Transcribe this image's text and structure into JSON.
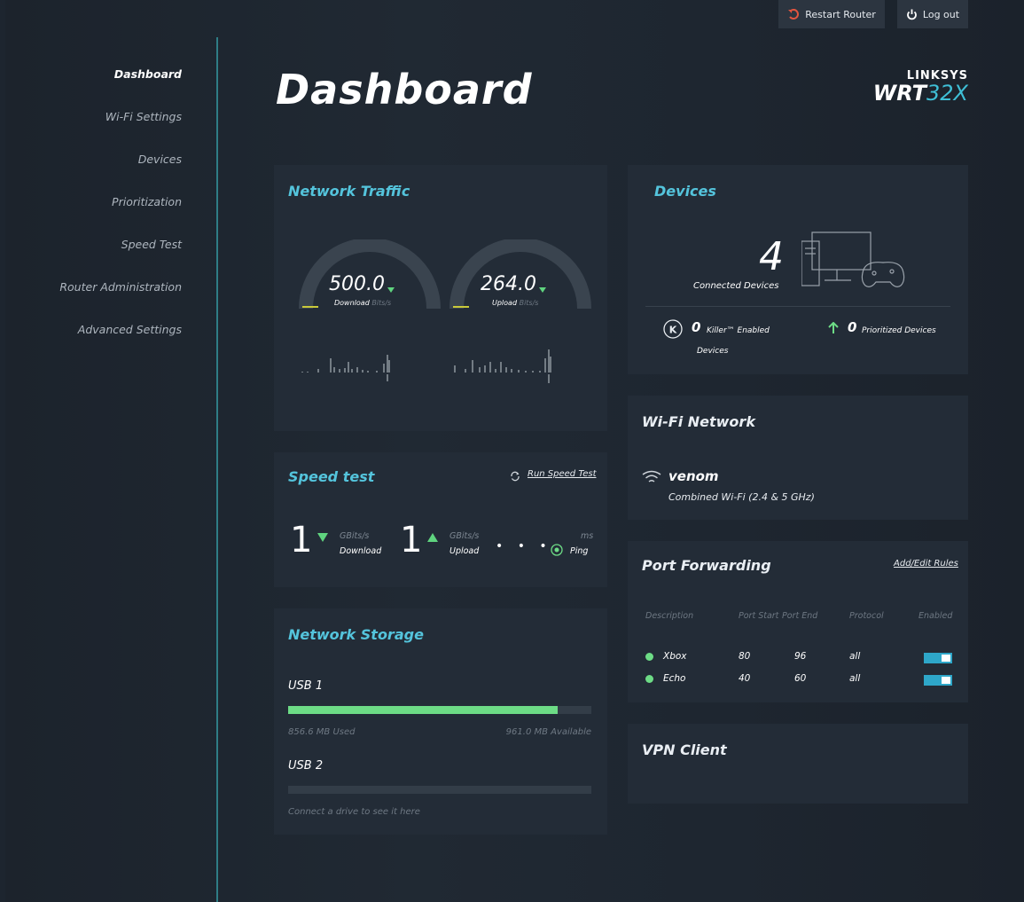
{
  "topbar": {
    "restart_label": "Restart Router",
    "logout_label": "Log out"
  },
  "sidebar": {
    "items": [
      {
        "label": "Dashboard",
        "active": true
      },
      {
        "label": "Wi-Fi Settings"
      },
      {
        "label": "Devices"
      },
      {
        "label": "Prioritization"
      },
      {
        "label": "Speed Test"
      },
      {
        "label": "Router Administration"
      },
      {
        "label": "Advanced Settings"
      }
    ]
  },
  "page": {
    "title": "Dashboard"
  },
  "logo": {
    "brand": "LINKSYS",
    "model_prefix": "WRT",
    "model_suffix": "32X"
  },
  "network_traffic": {
    "title": "Network Traffic",
    "download": {
      "value": "500.0",
      "label": "Download",
      "unit": "Bits/s"
    },
    "upload": {
      "value": "264.0",
      "label": "Upload",
      "unit": "Bits/s"
    }
  },
  "speed_test": {
    "title": "Speed test",
    "run_label": "Run Speed Test",
    "download": {
      "value": "1",
      "unit": "GBits/s",
      "label": "Download"
    },
    "upload": {
      "value": "1",
      "unit": "GBits/s",
      "label": "Upload"
    },
    "ping": {
      "value": "• • •",
      "unit": "ms",
      "label": "Ping"
    }
  },
  "storage": {
    "title": "Network Storage",
    "drives": [
      {
        "name": "USB 1",
        "used": "856.6 MB Used",
        "available": "961.0 MB Available",
        "fill_percent": 89
      },
      {
        "name": "USB 2",
        "empty_text": "Connect a drive to see it here",
        "fill_percent": 0
      }
    ]
  },
  "devices": {
    "title": "Devices",
    "connected_count": "4",
    "connected_label": "Connected Devices",
    "killer_count": "0",
    "killer_label_1": "Killer™ Enabled",
    "killer_label_2": "Devices",
    "prioritized_count": "0",
    "prioritized_label": "Prioritized Devices"
  },
  "wifi": {
    "title": "Wi-Fi Network",
    "ssid": "venom",
    "description": "Combined Wi-Fi (2.4 & 5 GHz)"
  },
  "port_forwarding": {
    "title": "Port Forwarding",
    "add_edit_label": "Add/Edit Rules",
    "headers": {
      "description": "Description",
      "port_start": "Port Start",
      "port_end": "Port End",
      "protocol": "Protocol",
      "enabled": "Enabled"
    },
    "rows": [
      {
        "description": "Xbox",
        "port_start": "80",
        "port_end": "96",
        "protocol": "all",
        "enabled": true
      },
      {
        "description": "Echo",
        "port_start": "40",
        "port_end": "60",
        "protocol": "all",
        "enabled": true
      }
    ]
  },
  "vpn": {
    "title": "VPN Client"
  },
  "colors": {
    "accent_cyan": "#54c4dc",
    "accent_green": "#6ddc86",
    "sidebar_line": "#2f7d86",
    "card_bg": "#232c37"
  }
}
